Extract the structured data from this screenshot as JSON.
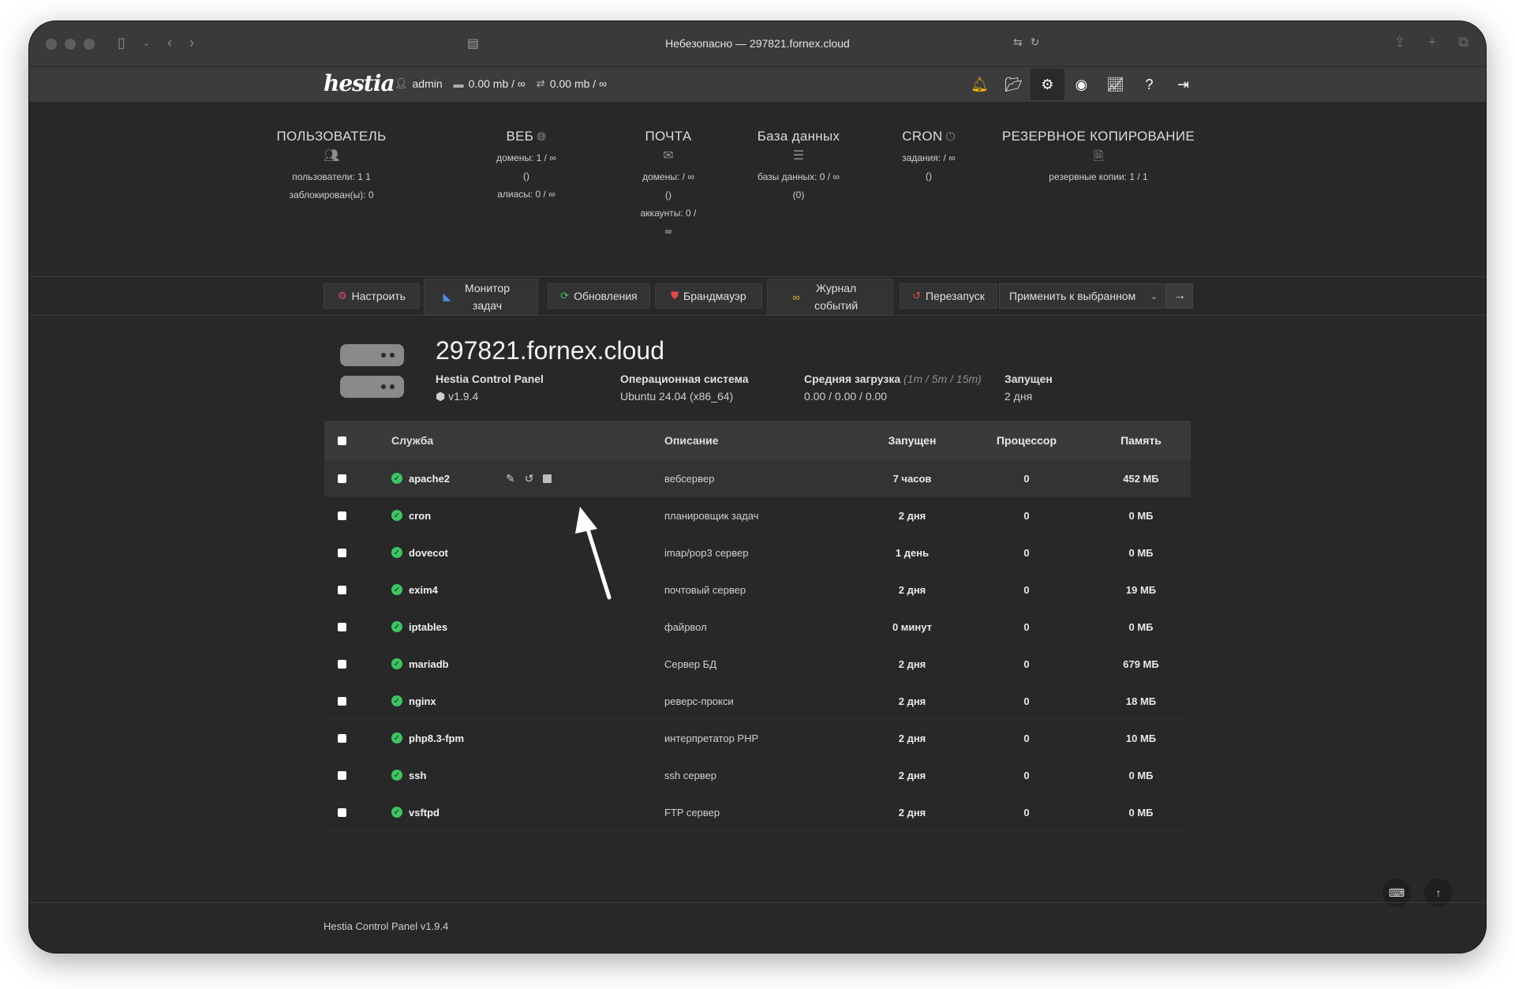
{
  "browser": {
    "title": "Небезопасно — 297821.fornex.cloud"
  },
  "topbar": {
    "logo": "hestia",
    "user": "admin",
    "disk": "0.00 mb / ∞",
    "bandwidth": "0.00 mb / ∞"
  },
  "stats": [
    {
      "heading": "ПОЛЬЗОВАТЕЛЬ",
      "icon": "users-icon",
      "lines": [
        "пользователи: 1 1",
        "заблокирован(ы): 0"
      ]
    },
    {
      "heading": "ВЕБ",
      "icon": "globe-icon",
      "lines": [
        "домены: 1 / ∞",
        "()",
        "алиасы: 0 / ∞"
      ]
    },
    {
      "heading": "ПОЧТА",
      "icon": "mail-icon",
      "lines": [
        "домены: / ∞",
        "()",
        "аккаунты: 0 /",
        "∞"
      ]
    },
    {
      "heading": "База данных",
      "icon": "database-icon",
      "lines": [
        "базы данных: 0 / ∞",
        "(0)"
      ]
    },
    {
      "heading": "CRON",
      "icon": "clock-icon",
      "lines": [
        "задания: / ∞",
        "()"
      ]
    },
    {
      "heading": "РЕЗЕРВНОЕ КОПИРОВАНИЕ",
      "icon": "file-icon",
      "lines": [
        "резервные копии: 1 / 1"
      ]
    }
  ],
  "toolbar": {
    "configure": "Настроить",
    "task_monitor_1": "Монитор",
    "task_monitor_2": "задач",
    "updates": "Обновления",
    "firewall": "Брандмауэр",
    "log_1": "Журнал",
    "log_2": "событий",
    "restart": "Перезапуск",
    "apply_select": "Применить к выбранном"
  },
  "server": {
    "hostname": "297821.fornex.cloud",
    "panel_label": "Hestia Control Panel",
    "panel_version": "v1.9.4",
    "os_label": "Операционная система",
    "os_value": "Ubuntu 24.04 (x86_64)",
    "load_label": "Средняя загрузка",
    "load_hint": "(1m / 5m / 15m)",
    "load_value": "0.00 / 0.00 / 0.00",
    "uptime_label": "Запущен",
    "uptime_value": "2 дня"
  },
  "table": {
    "headers": {
      "service": "Служба",
      "description": "Описание",
      "uptime": "Запущен",
      "cpu": "Процессор",
      "memory": "Память"
    },
    "rows": [
      {
        "name": "apache2",
        "desc": "вебсервер",
        "uptime": "7 часов",
        "cpu": "0",
        "mem": "452 МБ"
      },
      {
        "name": "cron",
        "desc": "планировщик задач",
        "uptime": "2 дня",
        "cpu": "0",
        "mem": "0 МБ"
      },
      {
        "name": "dovecot",
        "desc": "imap/pop3 сервер",
        "uptime": "1 день",
        "cpu": "0",
        "mem": "0 МБ"
      },
      {
        "name": "exim4",
        "desc": "почтовый сервер",
        "uptime": "2 дня",
        "cpu": "0",
        "mem": "19 МБ"
      },
      {
        "name": "iptables",
        "desc": "файрвол",
        "uptime": "0 минут",
        "cpu": "0",
        "mem": "0 МБ"
      },
      {
        "name": "mariadb",
        "desc": "Сервер БД",
        "uptime": "2 дня",
        "cpu": "0",
        "mem": "679 МБ"
      },
      {
        "name": "nginx",
        "desc": "реверс-прокси",
        "uptime": "2 дня",
        "cpu": "0",
        "mem": "18 МБ"
      },
      {
        "name": "php8.3-fpm",
        "desc": "интерпретатор PHP",
        "uptime": "2 дня",
        "cpu": "0",
        "mem": "10 МБ"
      },
      {
        "name": "ssh",
        "desc": "ssh сервер",
        "uptime": "2 дня",
        "cpu": "0",
        "mem": "0 МБ"
      },
      {
        "name": "vsftpd",
        "desc": "FTP сервер",
        "uptime": "2 дня",
        "cpu": "0",
        "mem": "0 МБ"
      }
    ]
  },
  "footer": {
    "text": "Hestia Control Panel v1.9.4"
  }
}
